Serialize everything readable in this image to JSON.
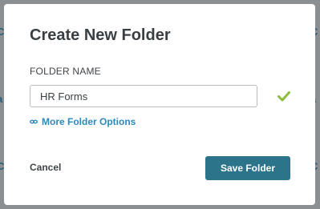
{
  "background": {
    "partial_links": [
      "C",
      "C",
      "a",
      "a",
      "C",
      "C"
    ]
  },
  "dialog": {
    "title": "Create New Folder",
    "field_label": "FOLDER NAME",
    "folder_name_value": "HR Forms",
    "valid_icon": "checkmark-icon",
    "more_options_icon": "link-icon",
    "more_options_label": "More Folder Options",
    "cancel_label": "Cancel",
    "save_label": "Save Folder"
  },
  "colors": {
    "accent_button": "#2c7489",
    "link": "#2a8ac0",
    "check": "#8bbd3c"
  }
}
